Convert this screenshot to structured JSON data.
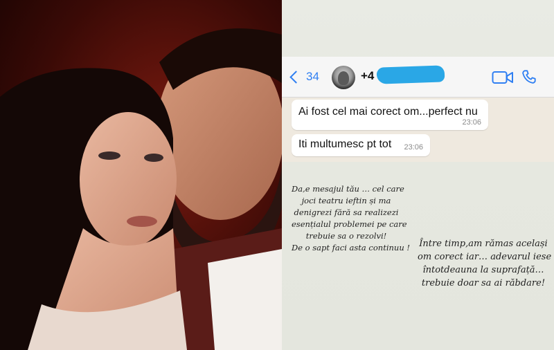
{
  "chat": {
    "back_count": "34",
    "contact_prefix": "+4",
    "messages": [
      {
        "text": "Ai fost cel mai corect om...perfect nu",
        "time": "23:06"
      },
      {
        "text": "Iti multumesc pt tot",
        "time": "23:06"
      }
    ]
  },
  "caption_left": [
    "Da,e mesajul tău … cel care",
    "joci teatru ieftin și ma",
    "denigrezi fără sa realizezi",
    "esențialul problemei pe care",
    "trebuie sa o rezolvi!",
    "De o sapt faci asta continuu !"
  ],
  "caption_right": [
    "Între timp,am rămas același",
    "om corect iar… adevarul iese",
    "întotdeauna la suprafață…",
    "trebuie doar sa ai  răbdare!"
  ],
  "colors": {
    "accent": "#2f7ff2",
    "chat_background": "#efe9df",
    "bubble": "#ffffff",
    "redaction": "#2aa7e6"
  },
  "icons": {
    "back": "chevron-left-icon",
    "video": "video-camera-icon",
    "phone": "phone-icon"
  }
}
